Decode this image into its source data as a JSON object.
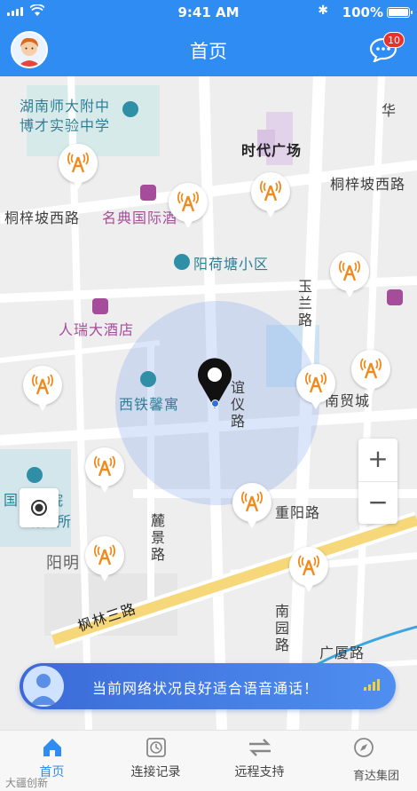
{
  "status_bar": {
    "time": "9:41 AM",
    "battery": "100%"
  },
  "nav": {
    "title": "首页",
    "message_badge": "10"
  },
  "map": {
    "labels": {
      "school": "湖南师大附中",
      "school2": "博才实验中学",
      "plaza": "时代广场",
      "road_tongzi_west_left": "桐梓坡西路",
      "road_tongzi_west_right": "桐梓坡西路",
      "hotel_mingdian": "名典国际酒",
      "community_yanghetang": "阳荷塘小区",
      "road_yulan": "玉兰路",
      "hotel_renrui": "人瑞大酒店",
      "apartment_xitie": "西铁馨寓",
      "road_yiyi_fragment": "谊仪路",
      "mall": "南贸城",
      "road_chongyang": "重阳路",
      "road_luijing": "麓景路",
      "area_yangming": "阳明",
      "road_fenglin3": "枫林三路",
      "road_nanyuan": "南园路",
      "road_guangsha": "广厦路",
      "institute": "国农学院",
      "institute2": "研究所",
      "road_hua": "华",
      "road_hua2": "路"
    }
  },
  "controls": {
    "zoom_in": "+",
    "zoom_out": "−"
  },
  "banner": {
    "text": "当前网络状况良好适合语音通话！"
  },
  "tabs": [
    {
      "label": "首页",
      "active": true
    },
    {
      "label": "连接记录",
      "active": false
    },
    {
      "label": "远程支持",
      "active": false
    },
    {
      "label": "",
      "active": false
    }
  ],
  "watermarks": {
    "left": "大疆创新",
    "right": "育达集团"
  },
  "colors": {
    "primary": "#2f8cf2",
    "tower": "#f08a1c",
    "badge": "#e8322b"
  }
}
